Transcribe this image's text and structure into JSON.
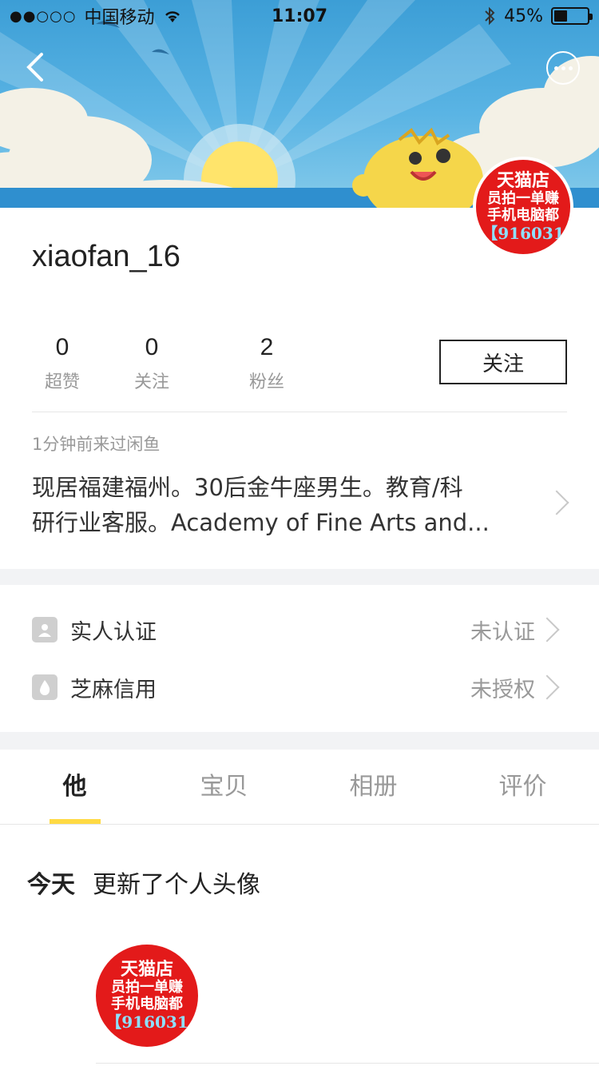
{
  "status_bar": {
    "signal": "●●○○○",
    "carrier": "中国移动",
    "time": "11:07",
    "battery_percent": "45%"
  },
  "header": {
    "back_icon": "chevron-left-icon",
    "more_icon": "more-dots-icon"
  },
  "avatar": {
    "line1": "天猫店",
    "line2": "员拍一单赚",
    "line3": "手机电脑都",
    "line4": "【916031"
  },
  "profile": {
    "username": "xiaofan_16",
    "stats": [
      {
        "value": "0",
        "label": "超赞"
      },
      {
        "value": "0",
        "label": "关注"
      },
      {
        "value": "2",
        "label": "粉丝"
      }
    ],
    "follow_label": "关注",
    "last_visit": "1分钟前来过闲鱼",
    "bio_line1": "现居福建福州。30后金牛座男生。教育/科",
    "bio_line2": "研行业客服。Academy of Fine Arts and..."
  },
  "verifications": [
    {
      "icon": "person-id-icon",
      "label": "实人认证",
      "value": "未认证"
    },
    {
      "icon": "sesame-credit-icon",
      "label": "芝麻信用",
      "value": "未授权"
    }
  ],
  "tabs": [
    {
      "label": "他",
      "active": true
    },
    {
      "label": "宝贝",
      "active": false
    },
    {
      "label": "相册",
      "active": false
    },
    {
      "label": "评价",
      "active": false
    }
  ],
  "timeline": {
    "day": "今天",
    "event": "更新了个人头像"
  },
  "post_avatar": {
    "line1": "天猫店",
    "line2": "员拍一单赚",
    "line3": "手机电脑都",
    "line4": "【916031"
  },
  "colors": {
    "accent_yellow": "#ffda44",
    "banner_blue": "#3c9ed6",
    "avatar_red": "#e31a1a"
  }
}
